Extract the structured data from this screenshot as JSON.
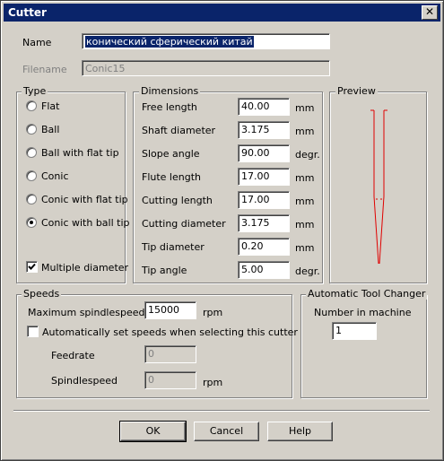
{
  "window": {
    "title": "Cutter",
    "close_glyph": "✕"
  },
  "name": {
    "label": "Name",
    "value": "конический сферический китай"
  },
  "filename": {
    "label": "Filename",
    "value": "Conic15"
  },
  "type": {
    "title": "Type",
    "options": [
      "Flat",
      "Ball",
      "Ball with flat tip",
      "Conic",
      "Conic with flat tip",
      "Conic with ball tip"
    ],
    "selected": "Conic with ball tip",
    "multiple_diameter": {
      "label": "Multiple diameter",
      "checked": true
    }
  },
  "dimensions": {
    "title": "Dimensions",
    "rows": [
      {
        "label": "Free length",
        "value": "40.00",
        "unit": "mm"
      },
      {
        "label": "Shaft diameter",
        "value": "3.175",
        "unit": "mm"
      },
      {
        "label": "Slope angle",
        "value": "90.00",
        "unit": "degr."
      },
      {
        "label": "Flute length",
        "value": "17.00",
        "unit": "mm"
      },
      {
        "label": "Cutting length",
        "value": "17.00",
        "unit": "mm"
      },
      {
        "label": "Cutting diameter",
        "value": "3.175",
        "unit": "mm"
      },
      {
        "label": "Tip diameter",
        "value": "0.20",
        "unit": "mm"
      },
      {
        "label": "Tip angle",
        "value": "5.00",
        "unit": "degr."
      }
    ]
  },
  "preview": {
    "title": "Preview",
    "line_color": "#e00000"
  },
  "speeds": {
    "title": "Speeds",
    "max_label": "Maximum spindlespeed",
    "max_value": "15000",
    "max_unit": "rpm",
    "auto_label": "Automatically set speeds when selecting this cutter",
    "auto_checked": false,
    "feedrate_label": "Feedrate",
    "feedrate_value": "0",
    "spindle_label": "Spindlespeed",
    "spindle_value": "0",
    "spindle_unit": "rpm"
  },
  "atc": {
    "title": "Automatic Tool Changer",
    "label": "Number in machine",
    "value": "1"
  },
  "buttons": {
    "ok": "OK",
    "cancel": "Cancel",
    "help": "Help"
  }
}
